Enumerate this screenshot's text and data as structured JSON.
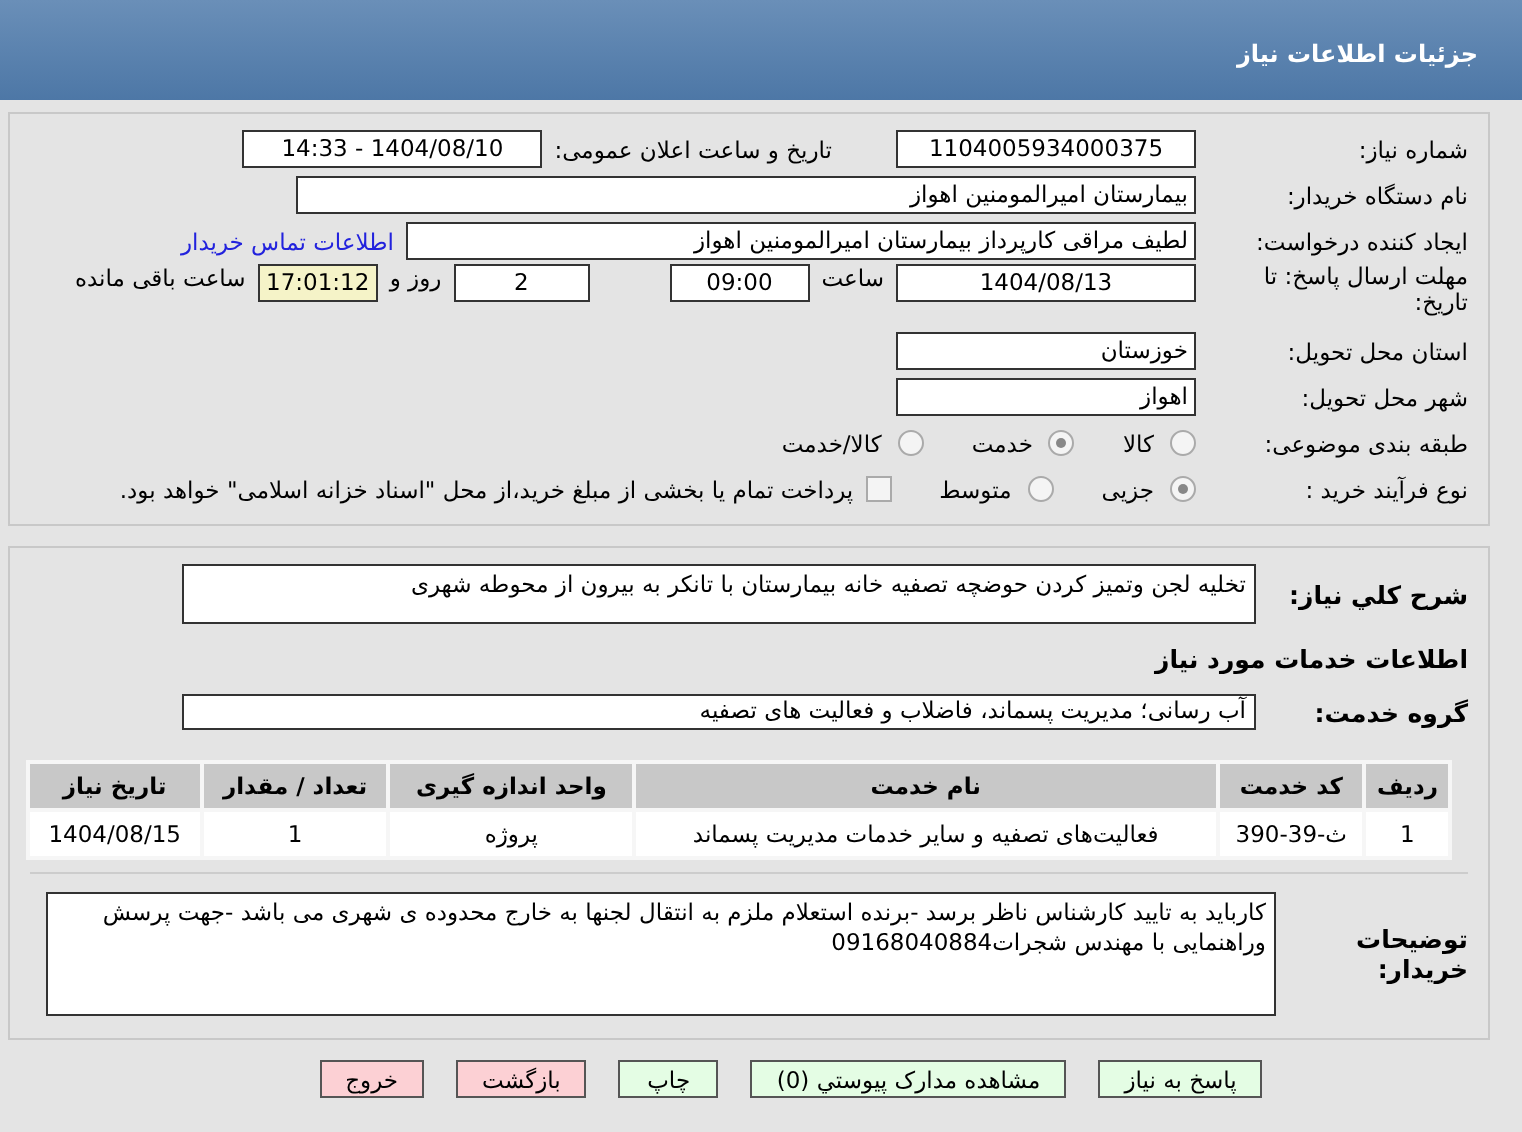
{
  "header": {
    "title": "جزئیات اطلاعات نیاز"
  },
  "need_number": {
    "label": "شماره نیاز:",
    "value": "1104005934000375"
  },
  "announce": {
    "label": "تاریخ و ساعت اعلان عمومی:",
    "value": "1404/08/10 - 14:33"
  },
  "buyer_org": {
    "label": "نام دستگاه خریدار:",
    "value": "بیمارستان امیرالمومنین اهواز"
  },
  "requester": {
    "label": "ایجاد کننده درخواست:",
    "value": "لطیف مراقی کارپرداز بیمارستان امیرالمومنین اهواز",
    "link": "اطلاعات تماس خریدار"
  },
  "deadline": {
    "label": "مهلت ارسال پاسخ: تا تاریخ:",
    "date": "1404/08/13",
    "time_label": "ساعت",
    "time": "09:00",
    "days": "2",
    "days_label": "روز و",
    "remaining": "17:01:12",
    "remaining_label": "ساعت باقی مانده"
  },
  "province": {
    "label": "استان محل تحویل:",
    "value": "خوزستان"
  },
  "city": {
    "label": "شهر محل تحویل:",
    "value": "اهواز"
  },
  "category": {
    "label": "طبقه بندی موضوعی:",
    "options": [
      {
        "label": "کالا",
        "selected": false
      },
      {
        "label": "خدمت",
        "selected": true
      },
      {
        "label": "کالا/خدمت",
        "selected": false
      }
    ]
  },
  "process": {
    "label": "نوع فرآیند خرید :",
    "options": [
      {
        "label": "جزیی",
        "selected": true
      },
      {
        "label": "متوسط",
        "selected": false
      }
    ],
    "payment": {
      "checked": false,
      "label": "پرداخت تمام یا بخشی از مبلغ خرید،از محل \"اسناد خزانه اسلامی\" خواهد بود."
    }
  },
  "description": {
    "label": "شرح کلي نياز:",
    "value": "تخلیه لجن وتمیز کردن حوضچه تصفیه خانه بیمارستان با تانکر به بیرون از محوطه شهری"
  },
  "services_title": "اطلاعات خدمات مورد نياز",
  "service_group": {
    "label": "گروه خدمت:",
    "value": "آب رسانی؛ مدیریت پسماند، فاضلاب و فعالیت های تصفیه"
  },
  "table": {
    "columns": [
      "ردیف",
      "کد خدمت",
      "نام خدمت",
      "واحد اندازه گیری",
      "تعداد / مقدار",
      "تاریخ نیاز"
    ],
    "rows": [
      [
        "1",
        "ث-39-390",
        "فعالیت‌های تصفیه و سایر خدمات مدیریت پسماند",
        "پروژه",
        "1",
        "1404/08/15"
      ]
    ]
  },
  "buyer_notes": {
    "label": "توضیحات خریدار:",
    "value": "کاربايد به تاييد کارشناس ناظر برسد -برنده استعلام ملزم به انتقال لجنها به خارج محدوده ی شهری  می باشد -جهت پرسش وراهنمایی با مهندس شجرات09168040884"
  },
  "buttons": [
    {
      "label": "پاسخ به نیاز",
      "kind": "primary"
    },
    {
      "label": "مشاهده مدارک پیوستي (0)",
      "kind": "primary"
    },
    {
      "label": "چاپ",
      "kind": "primary"
    },
    {
      "label": "بازگشت",
      "kind": "danger"
    },
    {
      "label": "خروج",
      "kind": "danger"
    }
  ]
}
